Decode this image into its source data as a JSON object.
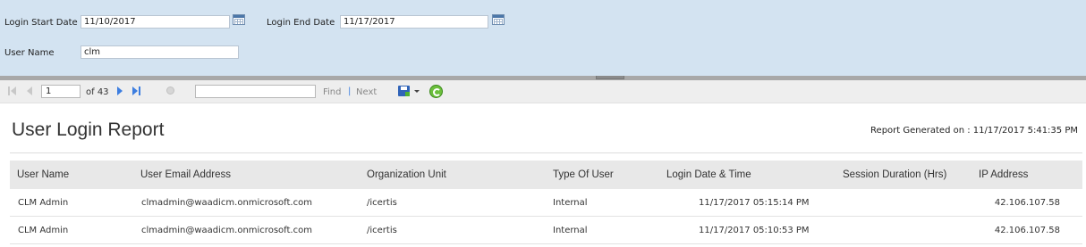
{
  "parameters": {
    "login_start_date_label": "Login Start Date",
    "login_start_date_value": "11/10/2017",
    "login_end_date_label": "Login End Date",
    "login_end_date_value": "11/17/2017",
    "user_name_label": "User Name",
    "user_name_value": "clm"
  },
  "toolbar": {
    "current_page": "1",
    "of_pages": "of 43",
    "find_label": "Find",
    "separator": "|",
    "next_label": "Next",
    "find_value": ""
  },
  "report": {
    "title": "User Login Report",
    "generated_on": "Report Generated on : 11/17/2017 5:41:35 PM",
    "columns": {
      "user_name": "User Name",
      "user_email": "User Email Address",
      "org_unit": "Organization Unit",
      "user_type": "Type Of User",
      "login_datetime": "Login Date & Time",
      "session_duration": "Session Duration (Hrs)",
      "ip_address": "IP Address"
    },
    "rows": [
      {
        "user_name": "CLM Admin",
        "user_email": "clmadmin@waadicm.onmicrosoft.com",
        "org_unit": "/icertis",
        "user_type": "Internal",
        "login_datetime": "11/17/2017 05:15:14 PM",
        "session_duration": "",
        "ip_address": "42.106.107.58"
      },
      {
        "user_name": "CLM Admin",
        "user_email": "clmadmin@waadicm.onmicrosoft.com",
        "org_unit": "/icertis",
        "user_type": "Internal",
        "login_datetime": "11/17/2017 05:10:53 PM",
        "session_duration": "",
        "ip_address": "42.106.107.58"
      }
    ]
  }
}
